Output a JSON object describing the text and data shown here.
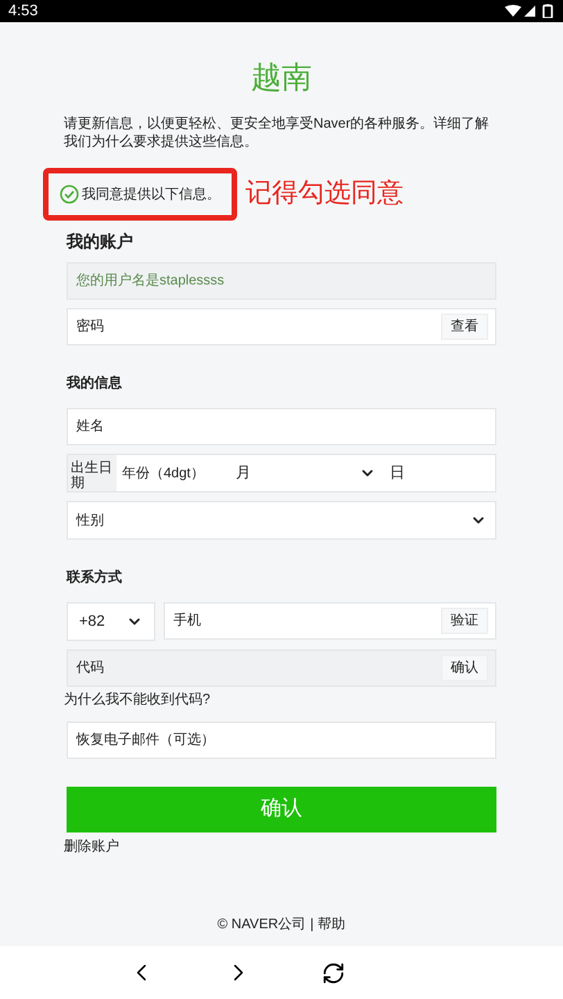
{
  "status_bar": {
    "time": "4:53"
  },
  "title": "越南",
  "description": "请更新信息，以便更轻松、更安全地享受Naver的各种服务。详细了解我们为什么要求提供这些信息。",
  "consent": {
    "label": "我同意提供以下信息。",
    "checked": true
  },
  "annotation": "记得勾选同意",
  "account": {
    "heading": "我的账户",
    "username": "您的用户名是staplessss",
    "password": {
      "placeholder": "密码",
      "button": "查看"
    }
  },
  "info": {
    "heading": "我的信息",
    "name": {
      "placeholder": "姓名"
    },
    "birthday": {
      "label": "出生日期",
      "year_placeholder": "年份（4dgt）",
      "month": "月",
      "day_placeholder": "日"
    },
    "gender": {
      "placeholder": "性别"
    }
  },
  "contact": {
    "heading": "联系方式",
    "country_code": "+82",
    "phone": {
      "placeholder": "手机",
      "button": "验证"
    },
    "code": {
      "placeholder": "代码",
      "button": "确认"
    },
    "help_link": "为什么我不能收到代码?",
    "email": {
      "placeholder": "恢复电子邮件（可选）"
    }
  },
  "submit": "确认",
  "delete_link": "删除账户",
  "footer": {
    "copyright": "© NAVER公司",
    "separator": "|",
    "help": "帮助"
  }
}
